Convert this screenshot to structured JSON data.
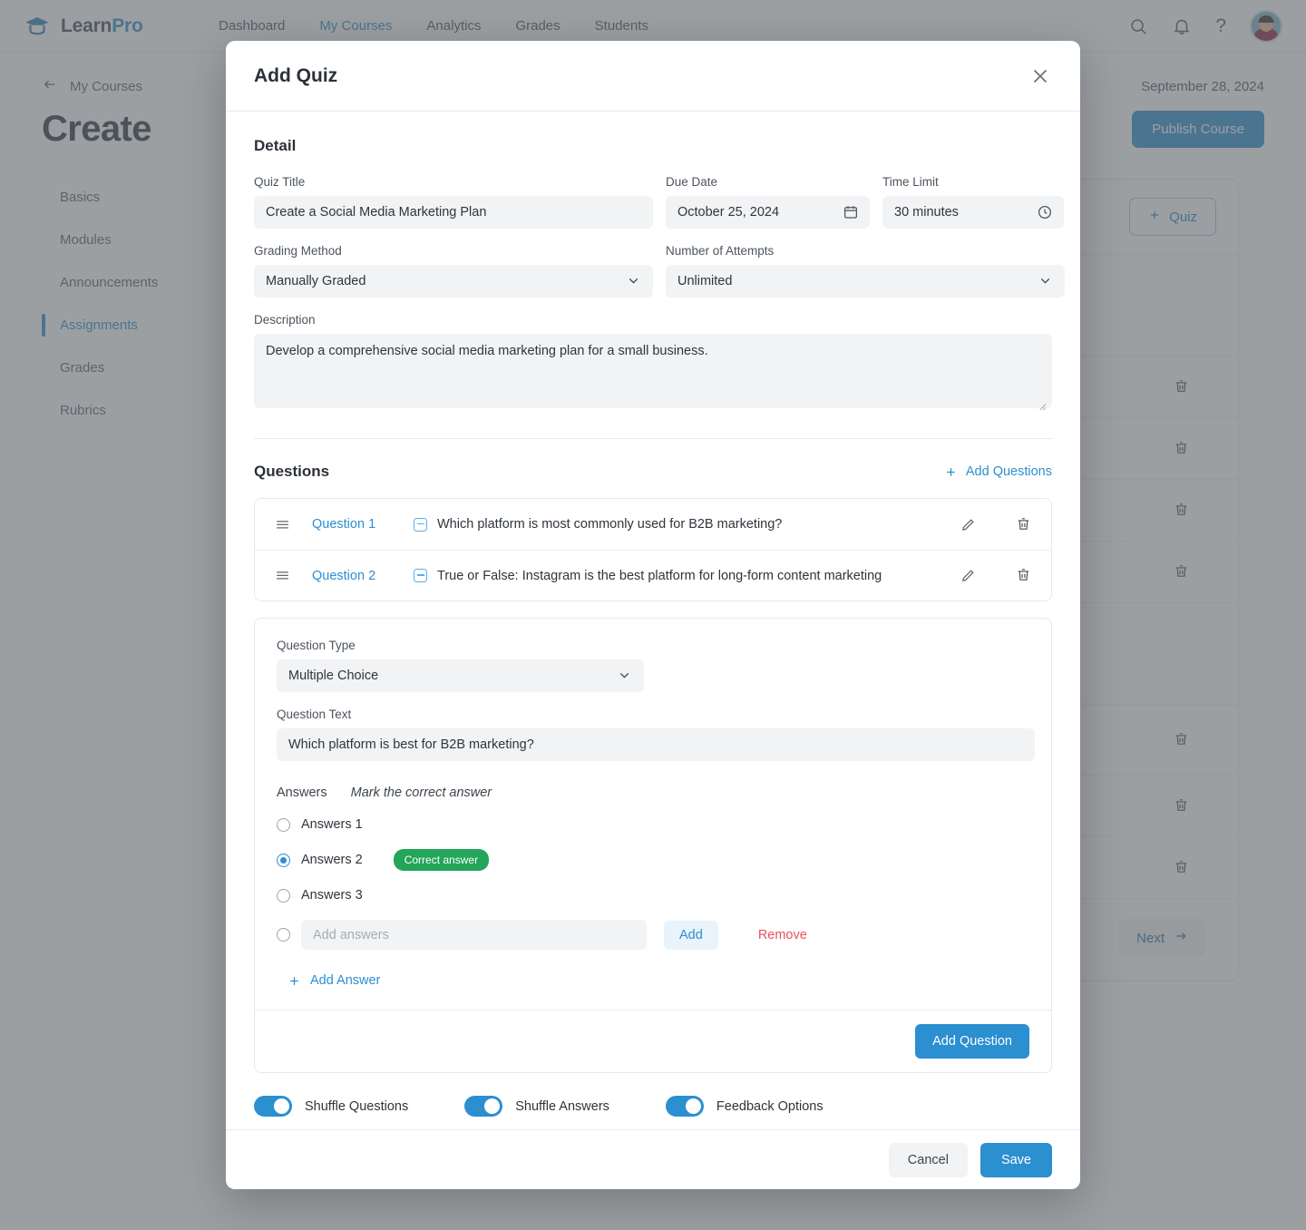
{
  "app": {
    "brand_learn": "Learn",
    "brand_pro": "Pro",
    "nav": [
      {
        "label": "Dashboard",
        "active": false
      },
      {
        "label": "My Courses",
        "active": true
      },
      {
        "label": "Analytics",
        "active": false
      },
      {
        "label": "Grades",
        "active": false
      },
      {
        "label": "Students",
        "active": false
      }
    ],
    "help_glyph": "?",
    "breadcrumb": "My Courses",
    "date": "September 28, 2024",
    "page_title": "Create",
    "publish_label": "Publish Course",
    "sidebar": [
      {
        "label": "Basics",
        "active": false
      },
      {
        "label": "Modules",
        "active": false
      },
      {
        "label": "Announcements",
        "active": false
      },
      {
        "label": "Assignments",
        "active": true
      },
      {
        "label": "Grades",
        "active": false
      },
      {
        "label": "Rubrics",
        "active": false
      }
    ],
    "quiz_button": "Quiz",
    "next_label": "Next",
    "accent": "#2b8fd0"
  },
  "modal": {
    "title": "Add Quiz",
    "detail_heading": "Detail",
    "fields": {
      "quiz_title_label": "Quiz Title",
      "quiz_title_value": "Create a Social Media Marketing Plan",
      "due_date_label": "Due Date",
      "due_date_value": "October 25, 2024",
      "time_limit_label": "Time Limit",
      "time_limit_value": "30 minutes",
      "grading_method_label": "Grading Method",
      "grading_method_value": "Manually Graded",
      "attempts_label": "Number of Attempts",
      "attempts_value": "Unlimited",
      "description_label": "Description",
      "description_value": "Develop a comprehensive social media marketing plan for a small business."
    },
    "questions": {
      "heading": "Questions",
      "add_link": "Add Questions",
      "rows": [
        {
          "num": "Question 1",
          "text": "Which platform is most commonly used for B2B marketing?"
        },
        {
          "num": "Question 2",
          "text": "True or False: Instagram is the best platform for long-form content marketing"
        }
      ]
    },
    "editor": {
      "question_type_label": "Question Type",
      "question_type_value": "Multiple Choice",
      "question_text_label": "Question Text",
      "question_text_value": "Which platform is best for B2B marketing?",
      "answers_label": "Answers",
      "mark_hint": "Mark the correct answer",
      "answers": [
        {
          "label": "Answers 1",
          "correct": false
        },
        {
          "label": "Answers 2",
          "correct": true
        },
        {
          "label": "Answers 3",
          "correct": false
        }
      ],
      "correct_badge": "Correct answer",
      "add_answer_placeholder": "Add answers",
      "add_button": "Add",
      "remove_button": "Remove",
      "add_answer_link": "Add Answer",
      "add_question_button": "Add Question"
    },
    "toggles": [
      {
        "label": "Shuffle Questions",
        "on": true
      },
      {
        "label": "Shuffle Answers",
        "on": true
      },
      {
        "label": "Feedback Options",
        "on": true
      }
    ],
    "footer": {
      "cancel": "Cancel",
      "save": "Save"
    }
  }
}
